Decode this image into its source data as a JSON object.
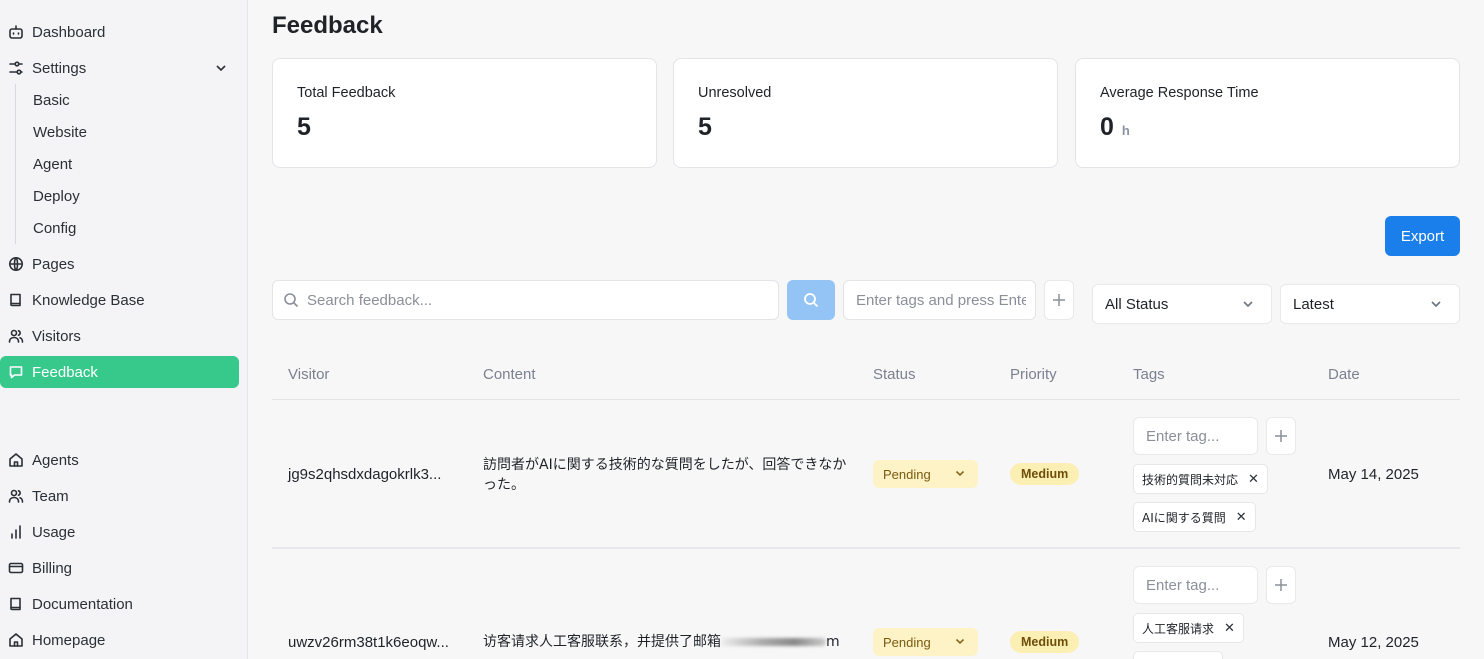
{
  "sidebar": {
    "items": [
      {
        "label": "Dashboard",
        "icon": "bot-icon"
      },
      {
        "label": "Settings",
        "icon": "sliders-icon"
      },
      {
        "label": "Pages",
        "icon": "globe-icon"
      },
      {
        "label": "Knowledge Base",
        "icon": "book-icon"
      },
      {
        "label": "Visitors",
        "icon": "users-icon"
      },
      {
        "label": "Feedback",
        "icon": "message-square-icon"
      },
      {
        "label": "Agents",
        "icon": "home-icon"
      },
      {
        "label": "Team",
        "icon": "users-icon"
      },
      {
        "label": "Usage",
        "icon": "bar-chart-icon"
      },
      {
        "label": "Billing",
        "icon": "credit-card-icon"
      },
      {
        "label": "Documentation",
        "icon": "book-icon"
      },
      {
        "label": "Homepage",
        "icon": "home-icon"
      }
    ],
    "settings_sub": [
      "Basic",
      "Website",
      "Agent",
      "Deploy",
      "Config"
    ],
    "active": "Feedback",
    "active_color": "#37c98c"
  },
  "page": {
    "title": "Feedback"
  },
  "stats": [
    {
      "label": "Total Feedback",
      "value": "5",
      "unit": ""
    },
    {
      "label": "Unresolved",
      "value": "5",
      "unit": ""
    },
    {
      "label": "Average Response Time",
      "value": "0",
      "unit": "h"
    }
  ],
  "toolbar": {
    "export_label": "Export",
    "export_color": "#1a7fea",
    "search_placeholder": "Search feedback...",
    "tags_placeholder": "Enter tags and press Enter",
    "status_value": "All Status",
    "sort_value": "Latest"
  },
  "table": {
    "headers": [
      "Visitor",
      "Content",
      "Status",
      "Priority",
      "Tags",
      "Date"
    ],
    "tag_placeholder": "Enter tag...",
    "rows": [
      {
        "visitor": "jg9s2qhsdxdagokrlk3...",
        "content": "訪問者がAIに関する技術的な質問をしたが、回答できなかった。",
        "status": "Pending",
        "priority": "Medium",
        "tags": [
          "技術的質問未対応",
          "AIに関する質問"
        ],
        "date": "May 14, 2025"
      },
      {
        "visitor": "uwzv26rm38t1k6eoqw...",
        "content_prefix": "访客请求人工客服联系，并提供了邮箱",
        "content_suffix": "m",
        "status": "Pending",
        "priority": "Medium",
        "tags": [
          "人工客服请求"
        ],
        "date": "May 12, 2025"
      }
    ]
  }
}
